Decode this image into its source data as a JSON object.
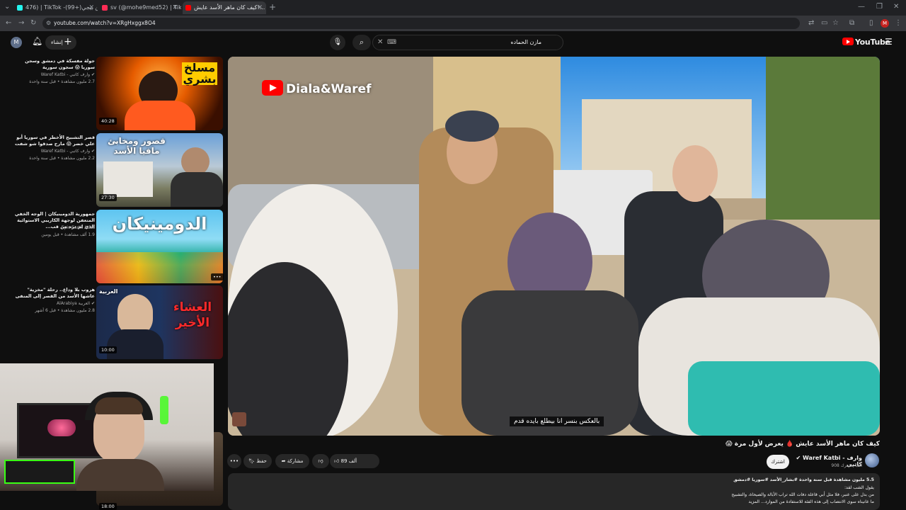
{
  "browser": {
    "tabs": [
      {
        "label": "476) | TikTok -(99+)وطن بيجي",
        "active": false,
        "color": "#25f4ee"
      },
      {
        "label": "sv (@mohe9med52) | TikTok",
        "active": false,
        "color": "#fe2c55"
      },
      {
        "label": "كيف كان ماهر الأسد عايش!...",
        "active": true,
        "color": "#ff0000"
      }
    ],
    "url": "youtube.com/watch?v=XRgHxggx8O4",
    "profile_initial": "M"
  },
  "header": {
    "search_value": "مازن الحماده",
    "search_keyboard": "⌨",
    "create_label": "إنشاء",
    "logo_text": "YouTube",
    "avatar_initial": "M"
  },
  "recommendations": [
    {
      "title": "جولة مفسكة في دمشق وسجن سوريا 😱 سجون سورية",
      "channel": "Waref Katbi - وارف كاتبي",
      "meta": "2.7 مليون مشاهدة • قبل سنة واحدة",
      "duration": "40:28",
      "thumb_text": "مسلخ بشري"
    },
    {
      "title": "قصر التشبيح الأخطر في سوريا أبو علي خضر 😱 مارح صدقوا شو شفت",
      "channel": "Waref Katbi - وارف كاتبي",
      "meta": "2.2 مليون مشاهدة • قبل سنة واحدة",
      "duration": "27:30",
      "thumb_text": "قصور ومخابئ مافيا الأسد"
    },
    {
      "title": "جمهورية الدومينيكان | الوجه الخفي المتعفن لوجهة الكاريبي الاستوائية الذي لم تره من قب...",
      "channel": "Epic Earth Atlas",
      "meta": "1.9 ألف مشاهدة • قبل يومين",
      "duration": "",
      "thumb_text": "الدومينيكان"
    },
    {
      "title": "هروب بلا وداع.. رحلة \"مخزية\" عاشها الأسد من القصر إلى المنفى",
      "channel": "AlArabiya العربية",
      "meta": "2.8 مليون مشاهدة • قبل 6 أشهر",
      "duration": "10:00",
      "thumb_text": "العشاء الأخير",
      "thumb_brand": "العربية"
    },
    {
      "title": "",
      "channel": "",
      "meta": "",
      "duration": "18:00",
      "thumb_text": ""
    }
  ],
  "player": {
    "watermark": "Diala&Waref",
    "subtitle": "بالعكس بنسر انا بيطلع بايده قدم"
  },
  "video": {
    "title": "كيف كان ماهر الأسد عايش 🩸 يعرض لأول مرة 😱",
    "channel_name": "Waref Katbi - وارف كاتبي",
    "subscribers": "908 ألف مشترك",
    "join_label": "اشترك",
    "like_label": "89 ألف",
    "share_label": "مشاركة",
    "save_label": "حفظ",
    "more_label": "•••"
  },
  "description": {
    "stats": "5.5 مليون مشاهدة قبل سنة واحدة  #بشار_الأسد #سوريا #دمشق",
    "line1": "يقول الشب لقد:",
    "line2": "من بدل على عنبر، فلا مثل أبي قاعلة دفات الله تراب الأبالة والصيحاة، والتشبيح",
    "line3": "ما عانيناه سوى الانتصاب إلى هذه الفئة للاستفادة من الموارد... المزيد"
  }
}
